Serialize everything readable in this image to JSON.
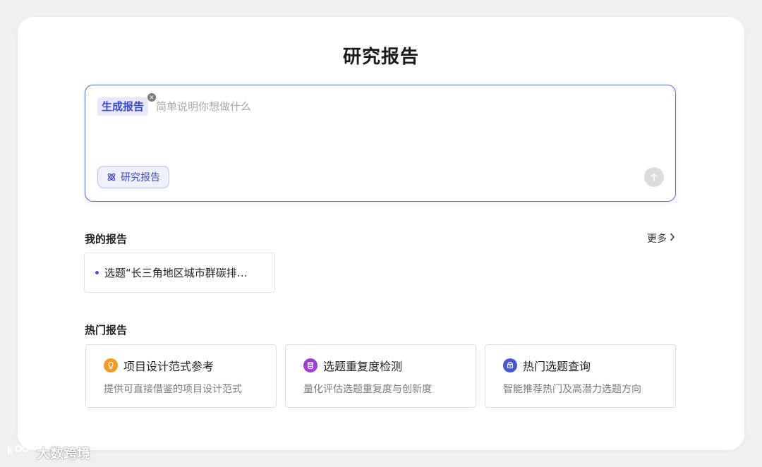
{
  "page": {
    "title": "研究报告"
  },
  "composer": {
    "mode_chip": "生成报告",
    "placeholder": "简单说明你想做什么",
    "value": "",
    "tool_chip": "研究报告",
    "tool_icon": "atom-icon",
    "send_icon": "arrow-up-icon"
  },
  "my_reports": {
    "title": "我的报告",
    "more": "更多",
    "items": [
      {
        "label": "选题“长三角地区城市群碳排…"
      }
    ]
  },
  "hot_reports": {
    "title": "热门报告",
    "items": [
      {
        "title": "项目设计范式参考",
        "desc": "提供可直接借鉴的项目设计范式",
        "icon": "lightbulb-icon",
        "color": "#f59a23"
      },
      {
        "title": "选题重复度检测",
        "desc": "量化评估选题重复度与创新度",
        "icon": "database-icon",
        "color": "#9b3fd8"
      },
      {
        "title": "热门选题查询",
        "desc": "智能推荐热门及高潜力选题方向",
        "icon": "archive-box-icon",
        "color": "#4a55d6"
      }
    ]
  },
  "colors": {
    "accent": "#4a55d6",
    "border_accent": "#5a67e0"
  },
  "watermark": {
    "text": "大数跨境",
    "icon": "brand-logo-icon"
  }
}
